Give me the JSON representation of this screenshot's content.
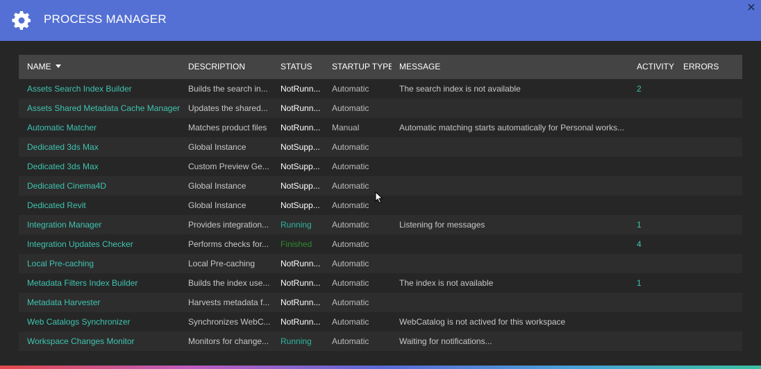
{
  "header": {
    "title": "PROCESS MANAGER",
    "icon": "gear-icon",
    "close_label": "✕"
  },
  "colors": {
    "header_bg": "#5470d4",
    "link": "#3fc4b0",
    "running": "#2fb5a0",
    "finished": "#2f8a2f"
  },
  "columns": {
    "name": "NAME",
    "description": "DESCRIPTION",
    "status": "STATUS",
    "startup": "STARTUP TYPE",
    "message": "MESSAGE",
    "activity": "ACTIVITY",
    "errors": "ERRORS"
  },
  "rows": [
    {
      "name": "Assets Search Index Builder",
      "description": "Builds the search in...",
      "status": "NotRunn...",
      "status_kind": "normal",
      "startup": "Automatic",
      "message": "The search index is not available",
      "activity": "2",
      "errors": ""
    },
    {
      "name": "Assets Shared Metadata Cache Manager",
      "description": "Updates the shared...",
      "status": "NotRunn...",
      "status_kind": "normal",
      "startup": "Automatic",
      "message": "",
      "activity": "",
      "errors": ""
    },
    {
      "name": "Automatic Matcher",
      "description": "Matches product files",
      "status": "NotRunn...",
      "status_kind": "normal",
      "startup": "Manual",
      "message": "Automatic matching starts automatically for Personal works...",
      "activity": "",
      "errors": ""
    },
    {
      "name": "Dedicated 3ds Max",
      "description": "Global Instance",
      "status": "NotSupp...",
      "status_kind": "normal",
      "startup": "Automatic",
      "message": "",
      "activity": "",
      "errors": ""
    },
    {
      "name": "Dedicated 3ds Max",
      "description": "Custom Preview Ge...",
      "status": "NotSupp...",
      "status_kind": "normal",
      "startup": "Automatic",
      "message": "",
      "activity": "",
      "errors": ""
    },
    {
      "name": "Dedicated Cinema4D",
      "description": "Global Instance",
      "status": "NotSupp...",
      "status_kind": "normal",
      "startup": "Automatic",
      "message": "",
      "activity": "",
      "errors": ""
    },
    {
      "name": "Dedicated Revit",
      "description": "Global Instance",
      "status": "NotSupp...",
      "status_kind": "normal",
      "startup": "Automatic",
      "message": "",
      "activity": "",
      "errors": ""
    },
    {
      "name": "Integration Manager",
      "description": "Provides integration...",
      "status": "Running",
      "status_kind": "running",
      "startup": "Automatic",
      "message": "Listening for messages",
      "activity": "1",
      "errors": ""
    },
    {
      "name": "Integration Updates Checker",
      "description": "Performs checks for...",
      "status": "Finished",
      "status_kind": "finished",
      "startup": "Automatic",
      "message": "",
      "activity": "4",
      "errors": ""
    },
    {
      "name": "Local Pre-caching",
      "description": "Local Pre-caching",
      "status": "NotRunn...",
      "status_kind": "normal",
      "startup": "Automatic",
      "message": "",
      "activity": "",
      "errors": ""
    },
    {
      "name": "Metadata Filters Index Builder",
      "description": "Builds the index use...",
      "status": "NotRunn...",
      "status_kind": "normal",
      "startup": "Automatic",
      "message": "The index is not available",
      "activity": "1",
      "errors": ""
    },
    {
      "name": "Metadata Harvester",
      "description": "Harvests metadata f...",
      "status": "NotRunn...",
      "status_kind": "normal",
      "startup": "Automatic",
      "message": "",
      "activity": "",
      "errors": ""
    },
    {
      "name": "Web Catalogs Synchronizer",
      "description": "Synchronizes WebC...",
      "status": "NotRunn...",
      "status_kind": "normal",
      "startup": "Automatic",
      "message": "WebCatalog is not actived for this workspace",
      "activity": "",
      "errors": ""
    },
    {
      "name": "Workspace Changes Monitor",
      "description": "Monitors for change...",
      "status": "Running",
      "status_kind": "running",
      "startup": "Automatic",
      "message": "Waiting for notifications...",
      "activity": "",
      "errors": ""
    }
  ]
}
